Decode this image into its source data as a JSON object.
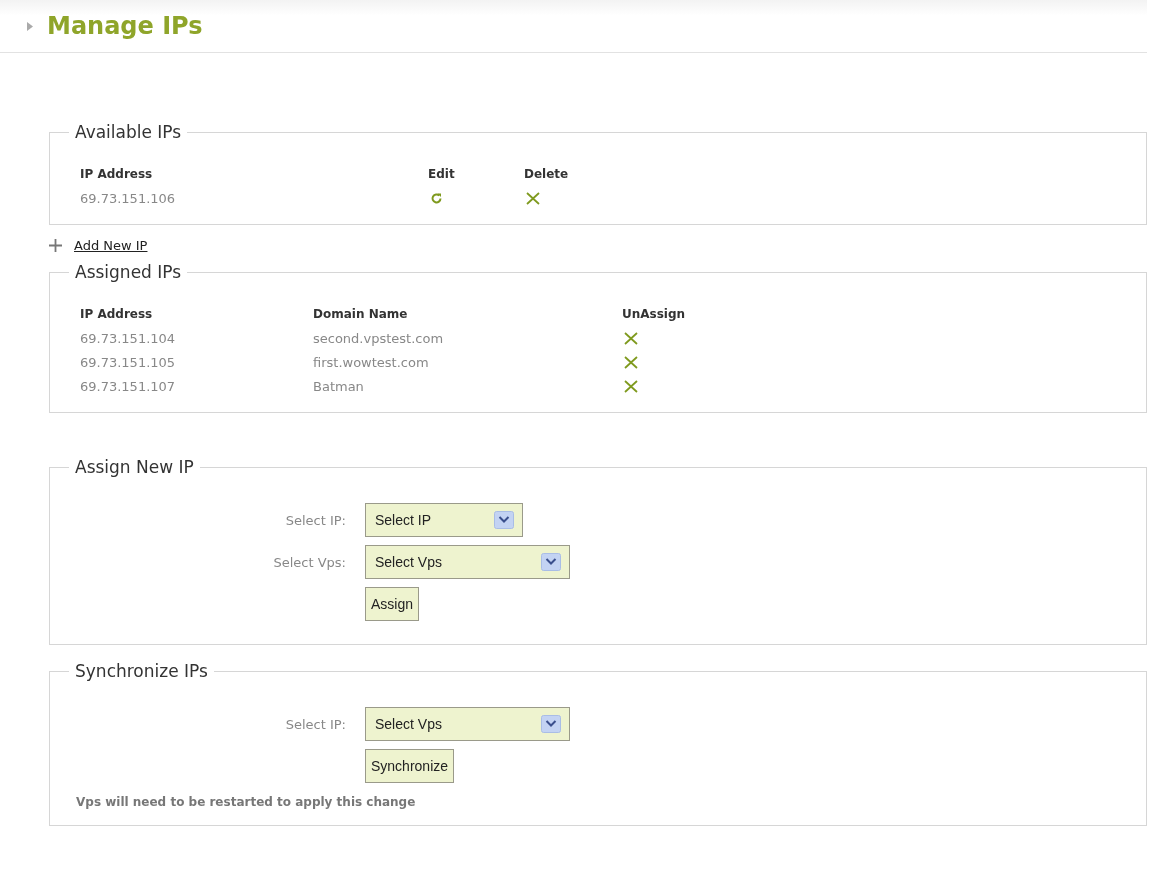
{
  "page_title": "Manage IPs",
  "available": {
    "title": "Available IPs",
    "columns": [
      "IP Address",
      "Edit",
      "Delete"
    ],
    "rows": [
      {
        "ip": "69.73.151.106"
      }
    ]
  },
  "add_link": "Add New IP",
  "assigned": {
    "title": "Assigned IPs",
    "columns": [
      "IP Address",
      "Domain Name",
      "UnAssign"
    ],
    "rows": [
      {
        "ip": "69.73.151.104",
        "domain": "second.vpstest.com"
      },
      {
        "ip": "69.73.151.105",
        "domain": "first.wowtest.com"
      },
      {
        "ip": "69.73.151.107",
        "domain": "Batman"
      }
    ]
  },
  "assign_form": {
    "title": "Assign New IP",
    "fields": [
      {
        "label": "Select IP:",
        "value": "Select IP",
        "kind": "short"
      },
      {
        "label": "Select Vps:",
        "value": "Select Vps",
        "kind": "long"
      }
    ],
    "button": "Assign"
  },
  "sync_form": {
    "title": "Synchronize IPs",
    "fields": [
      {
        "label": "Select IP:",
        "value": "Select Vps",
        "kind": "long"
      }
    ],
    "button": "Synchronize",
    "note": "Vps will need to be restarted to apply this change"
  }
}
